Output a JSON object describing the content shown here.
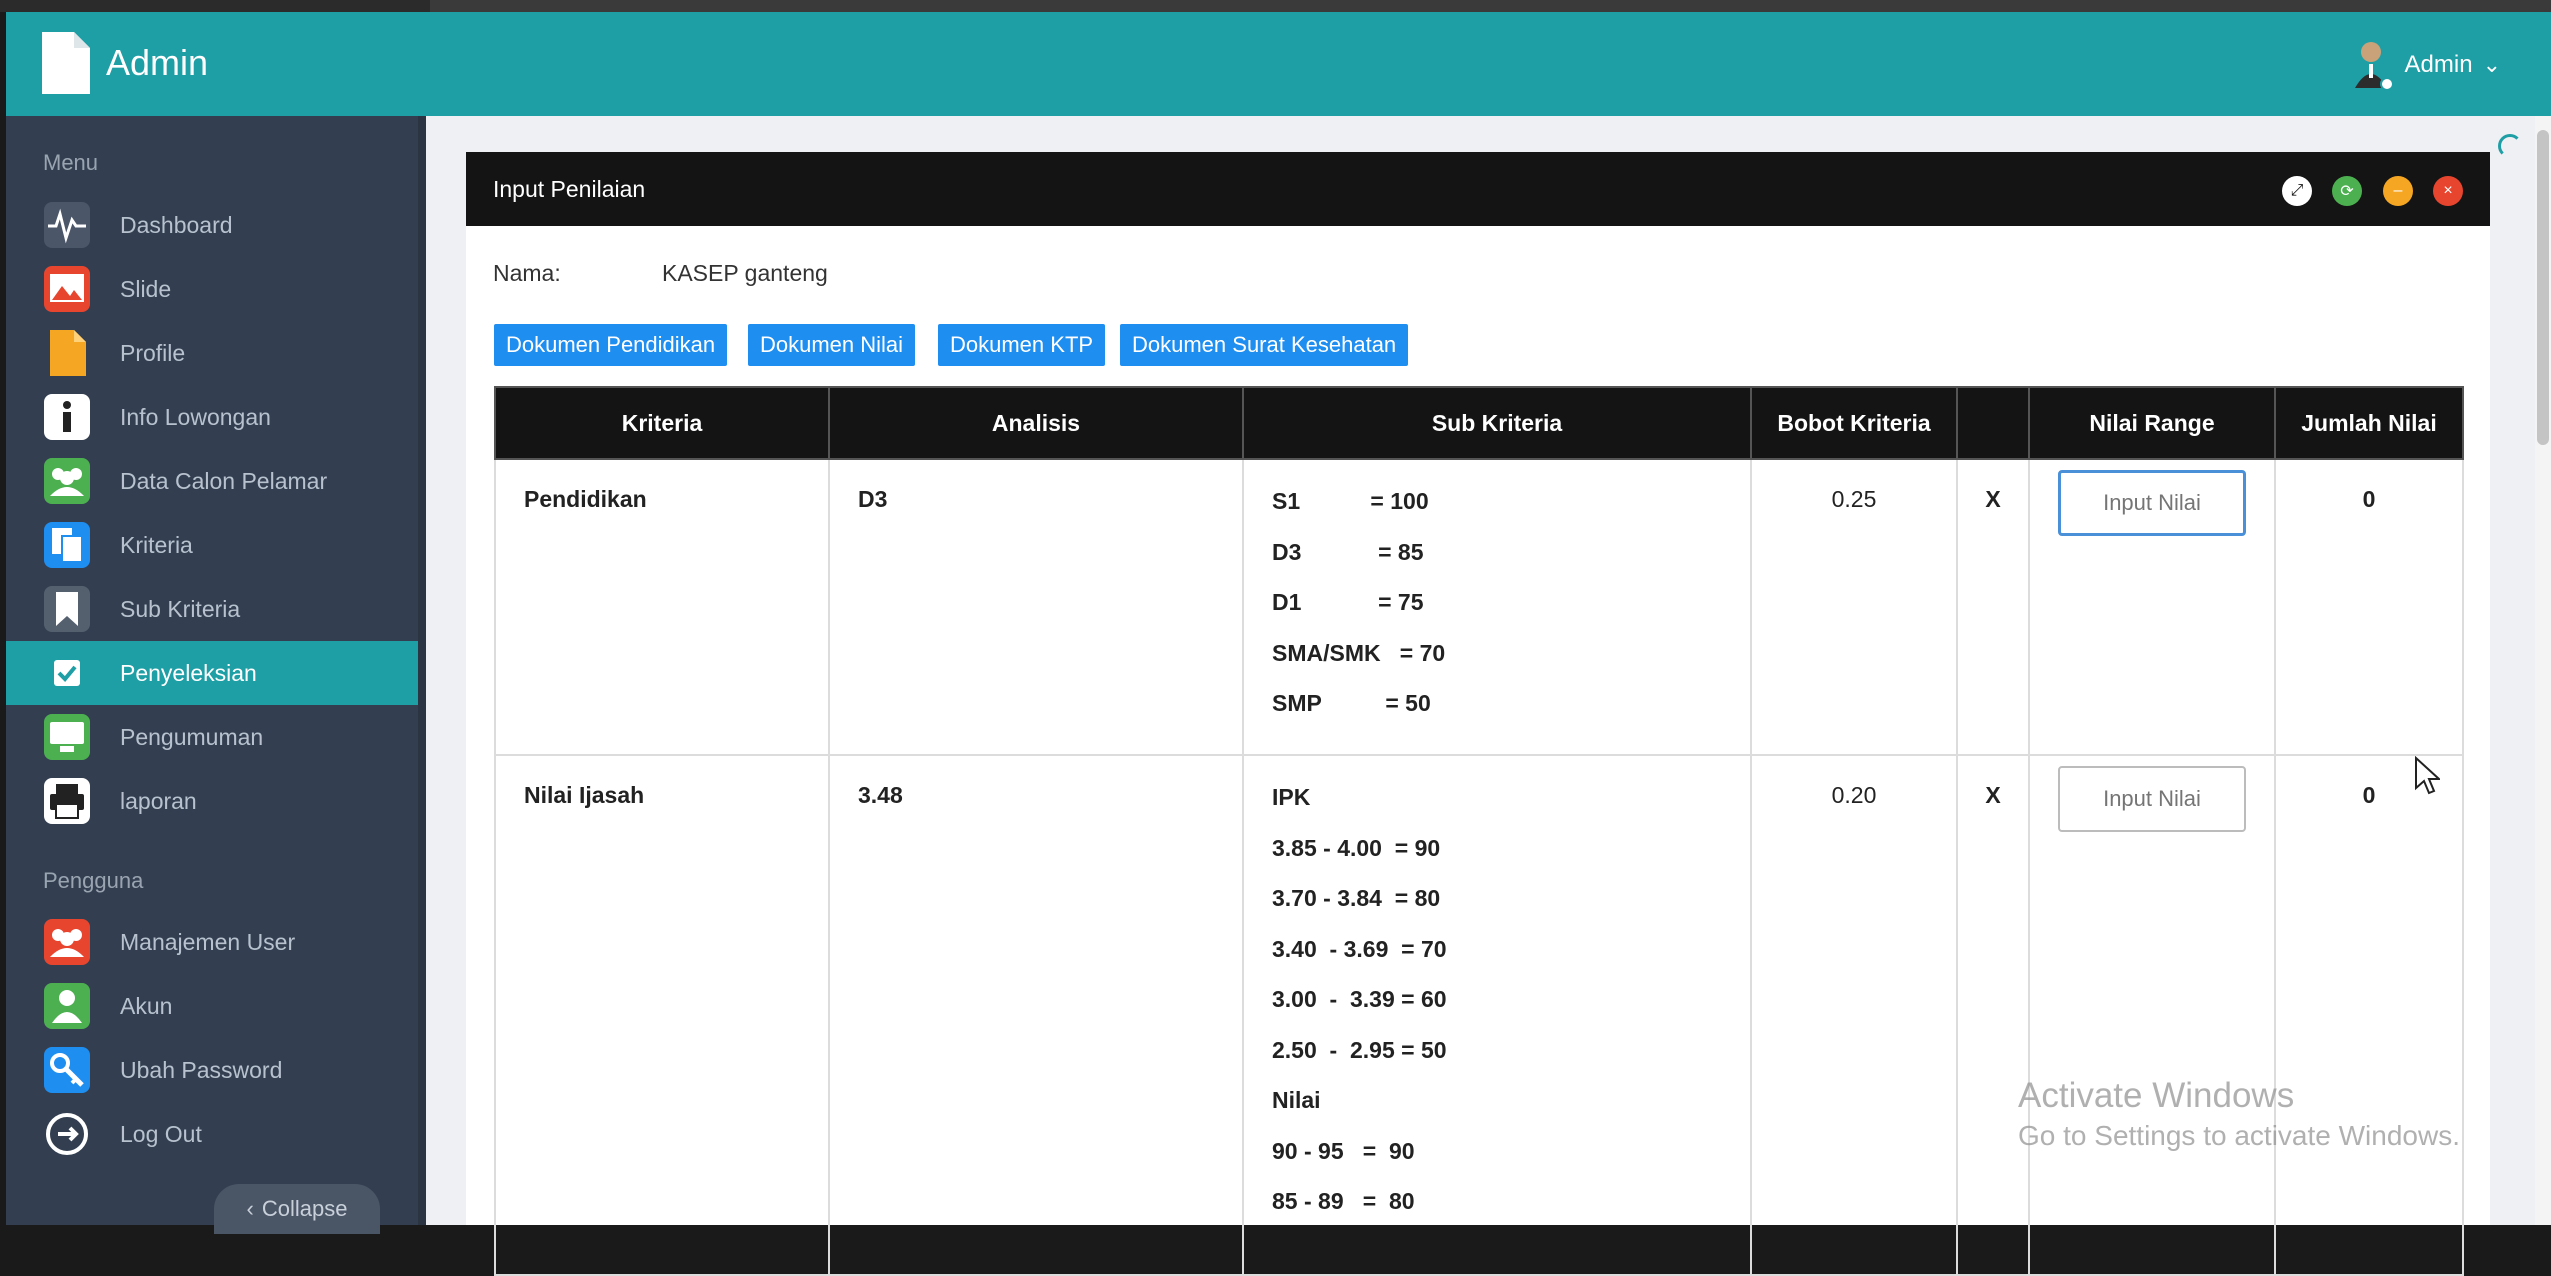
{
  "header": {
    "brand": "Admin",
    "user": "Admin"
  },
  "sidebar": {
    "menu_heading": "Menu",
    "items": [
      {
        "label": "Dashboard"
      },
      {
        "label": "Slide"
      },
      {
        "label": "Profile"
      },
      {
        "label": "Info Lowongan"
      },
      {
        "label": "Data Calon Pelamar"
      },
      {
        "label": "Kriteria"
      },
      {
        "label": "Sub Kriteria"
      },
      {
        "label": "Penyeleksian"
      },
      {
        "label": "Pengumuman"
      },
      {
        "label": "laporan"
      }
    ],
    "user_heading": "Pengguna",
    "user_items": [
      {
        "label": "Manajemen User"
      },
      {
        "label": "Akun"
      },
      {
        "label": "Ubah Password"
      },
      {
        "label": "Log Out"
      }
    ],
    "collapse": "Collapse"
  },
  "panel": {
    "title": "Input Penilaian",
    "nama_label": "Nama:",
    "nama_value": "KASEP ganteng",
    "doc_buttons": [
      "Dokumen Pendidikan",
      "Dokumen Nilai",
      "Dokumen KTP",
      "Dokumen Surat Kesehatan"
    ]
  },
  "table": {
    "headers": [
      "Kriteria",
      "Analisis",
      "Sub Kriteria",
      "Bobot Kriteria",
      "",
      "Nilai Range",
      "Jumlah Nilai"
    ],
    "rows": [
      {
        "kriteria": "Pendidikan",
        "analisis": "D3",
        "sub": [
          "S1           = 100",
          "D3            = 85",
          "D1            = 75",
          "SMA/SMK   = 70",
          "SMP          = 50"
        ],
        "bobot": "0.25",
        "x": "X",
        "placeholder": "Input Nilai",
        "jumlah": "0"
      },
      {
        "kriteria": "Nilai Ijasah",
        "analisis": "3.48",
        "sub": [
          "IPK",
          "3.85 - 4.00  = 90",
          "3.70 - 3.84  = 80",
          "3.40  - 3.69  = 70",
          "3.00  -  3.39 = 60",
          "2.50  -  2.95 = 50",
          "Nilai",
          "90 - 95   =  90",
          "85 - 89   =  80"
        ],
        "bobot": "0.20",
        "x": "X",
        "placeholder": "Input Nilai",
        "jumlah": "0"
      }
    ]
  },
  "watermark": {
    "line1": "Activate Windows",
    "line2": "Go to Settings to activate Windows."
  },
  "colors": {
    "header": "#1e9ea5",
    "sidebar": "#333f50",
    "active": "#1e9ea5",
    "doc_button": "#1f8ef1"
  }
}
